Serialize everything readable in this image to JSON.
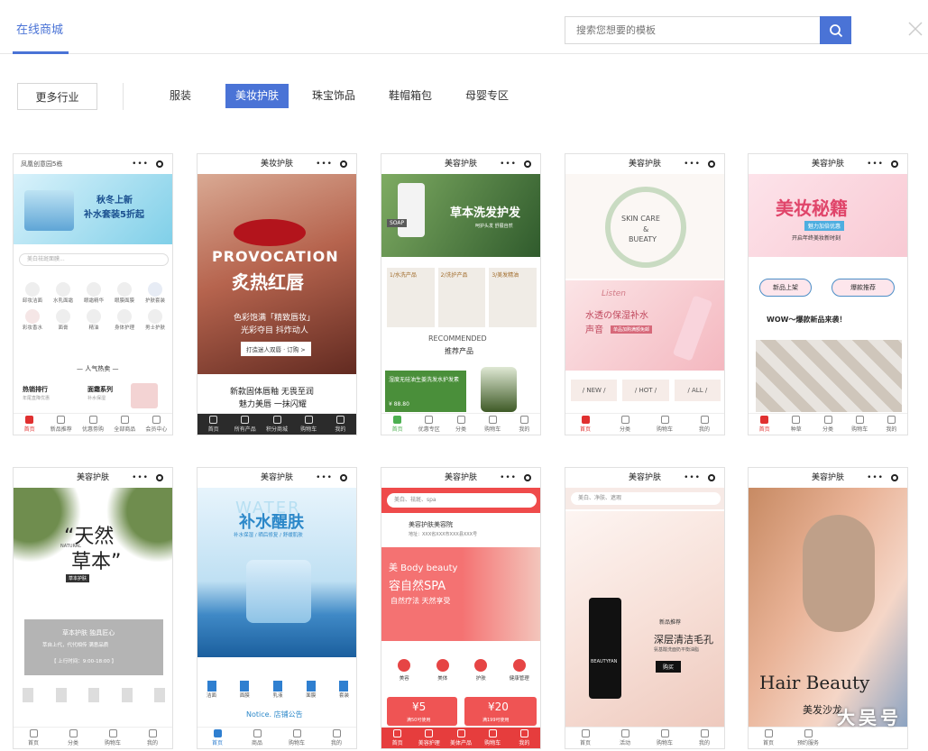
{
  "header": {
    "tab": "在线商城",
    "search_placeholder": "搜索您想要的模板"
  },
  "filters": {
    "more": "更多行业",
    "categories": [
      "服装",
      "美妆护肤",
      "珠宝饰品",
      "鞋帽箱包",
      "母婴专区"
    ],
    "active_index": 1
  },
  "templates": [
    {
      "title": "",
      "location": "凤凰创意园5栋",
      "banner_line1": "秋冬上新",
      "banner_line2": "补水套装5折起",
      "search_placeholder": "美白祛斑面膜...",
      "icons": [
        "卸妆洁面",
        "水乳面霜",
        "眼霜精华",
        "眼膜面膜",
        "护肤套装",
        "彩妆香水",
        "面膏",
        "精油",
        "身体护理",
        "男士护肤"
      ],
      "section": "人气热卖",
      "item1": "热销排行",
      "item1_sub": "年尾直降优惠",
      "item2": "面霜系列",
      "item2_sub": "补水保湿",
      "nav": [
        "首页",
        "新品推荐",
        "优惠劵购",
        "全部商品",
        "会员中心"
      ]
    },
    {
      "title": "美妆护肤",
      "hero_en": "PROVOCATION",
      "hero_cn": "炙热红唇",
      "line1": "色彩饱满「精致唇妆」",
      "line2": "光彩夺目 抖炸动人",
      "cta": "打造迷人双唇 · 订购 >",
      "footer1": "新款固体唇釉 无畏至润",
      "footer2": "魅力美唇 一抹闪耀",
      "nav": [
        "首页",
        "所有产品",
        "积分商城",
        "购物车",
        "我的"
      ]
    },
    {
      "title": "美容护肤",
      "banner_title": "草本洗发护发",
      "banner_sub": "呵护头发 舒展自然",
      "badge": "SOAP",
      "steps": [
        "1/水洗产品",
        "2/洗护产品",
        "3/美发精油"
      ],
      "rec_en": "RECOMMENDED",
      "rec_cn": "推荐产品",
      "promo": "湿度无硅油生姜洗发水护发素",
      "price": "¥ 88.80",
      "nav": [
        "首页",
        "优惠专区",
        "分类",
        "购物车",
        "我的"
      ]
    },
    {
      "title": "美容护肤",
      "wreath": [
        "SKIN CARE",
        "&",
        "BUEATY"
      ],
      "banner_en": "Listen",
      "banner_cn": "水透の保湿补水",
      "banner_cn2": "声音",
      "banner_tag": "单品加购满额免邮",
      "tags": [
        "/ NEW /",
        "/ HOT /",
        "/ ALL /"
      ],
      "nav": [
        "首页",
        "分类",
        "购物车",
        "我的"
      ]
    },
    {
      "title": "美容护肤",
      "banner": "美妆秘籍",
      "banner_sub": "魅力加倍优惠",
      "banner_sub2": "开启年终美妆新时刻",
      "btn1": "新品上架",
      "btn2": "爆款推荐",
      "wow": "WOW～爆款新品来袭！",
      "nav": [
        "首页",
        "种草",
        "分类",
        "购物车",
        "我的"
      ]
    },
    {
      "title": "美容护肤",
      "quote1": "“天然",
      "quote2": "草本”",
      "en": "NATURAL",
      "tag": "草本护肤",
      "box1": "草本护肤 独具匠心",
      "box2": "萃自上代，代代相传 满意品质",
      "box3": "【 上行时间：9:00-18:00 】",
      "nav": [
        "首页",
        "分类",
        "购物车",
        "我的"
      ]
    },
    {
      "title": "美容护肤",
      "water": "WATER",
      "hero": "补水醒肤",
      "sub": "补水保湿 / 晒后修复 / 舒缓肌肤",
      "icons": [
        "洁面",
        "面膜",
        "乳液",
        "面膜",
        "套装"
      ],
      "notice": "Notice. 店铺公告",
      "nav": [
        "首页",
        "商品",
        "购物车",
        "我的"
      ]
    },
    {
      "title": "美容护肤",
      "search": "美白、祛斑、spa",
      "store": "美容护肤美容院",
      "addr": "地址：XXX省XXX市XXX县XXX号",
      "hero1": "美 Body beauty",
      "hero2": "容自然SPA",
      "hero3": "自然疗法 天然享受",
      "icons": [
        "美容",
        "美体",
        "护肤",
        "健康管理"
      ],
      "coupon1": "¥5",
      "coupon1_sub": "满50可使用",
      "coupon2": "¥20",
      "coupon2_sub": "满199可使用",
      "nav": [
        "首页",
        "美容护理",
        "美体产品",
        "购物车",
        "我的"
      ]
    },
    {
      "title": "美容护肤",
      "search": "美白、净肤、遮瑕",
      "brand": "BEAUTYFAN",
      "tag": "新品推荐",
      "title2": "深层清洁毛孔",
      "sub": "氨基酸洗面奶平衡油脂",
      "buy": "购买",
      "nav": [
        "首页",
        "活动",
        "购物车",
        "我的"
      ]
    },
    {
      "title": "美容护肤",
      "hero1": "Hair Beauty",
      "hero2": "美发沙龙",
      "nav": [
        "首页",
        "预约服务"
      ]
    }
  ],
  "watermark": "大吴号"
}
